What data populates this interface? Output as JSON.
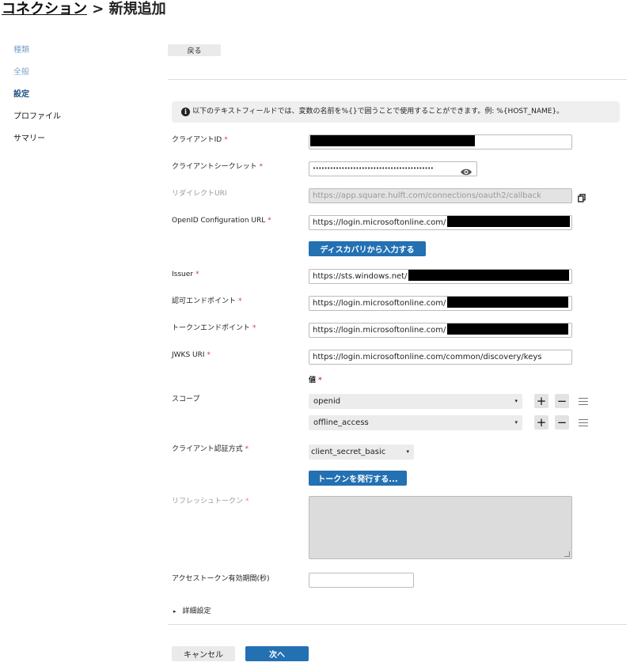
{
  "title": {
    "link": "コネクション",
    "rest": " > 新規追加"
  },
  "nav": [
    {
      "label": "種類",
      "state": "done"
    },
    {
      "label": "全般",
      "state": "done"
    },
    {
      "label": "設定",
      "state": "current"
    },
    {
      "label": "プロファイル",
      "state": "todo"
    },
    {
      "label": "サマリー",
      "state": "todo"
    }
  ],
  "back_label": "戻る",
  "info_text": "以下のテキストフィールドでは、変数の名前を%{}で囲うことで使用することができます。例: %{HOST_NAME}。",
  "required_mark": "*",
  "fields": {
    "client_id": {
      "label": "クライアントID"
    },
    "client_secret": {
      "label": "クライアントシークレット",
      "value": "••••••••••••••••••••••••••••••••••••••••••"
    },
    "redirect_uri": {
      "label": "リダイレクトURI",
      "value": "https://app.square.hulft.com/connections/oauth2/callback"
    },
    "openid_url": {
      "label": "OpenID Configuration URL",
      "value": "https://login.microsoftonline.com/"
    },
    "issuer": {
      "label": "Issuer",
      "value": "https://sts.windows.net/"
    },
    "auth_endpoint": {
      "label": "認可エンドポイント",
      "value": "https://login.microsoftonline.com/"
    },
    "token_endpoint": {
      "label": "トークンエンドポイント",
      "value": "https://login.microsoftonline.com/"
    },
    "jwks_uri": {
      "label": "JWKS URI",
      "value": "https://login.microsoftonline.com/common/discovery/keys"
    }
  },
  "discover_button": "ディスカバリから入力する",
  "scope": {
    "header": "値",
    "label": "スコープ",
    "values": [
      "openid",
      "offline_access"
    ]
  },
  "client_auth": {
    "label": "クライアント認証方式",
    "value": "client_secret_basic"
  },
  "issue_token_button": "トークンを発行する...",
  "refresh_token_label": "リフレッシュトークン",
  "access_token_ttl_label": "アクセストークン有効期間(秒)",
  "advanced_label": "詳細設定",
  "cancel_label": "キャンセル",
  "next_label": "次へ",
  "icons": {
    "info": "info-icon",
    "eye": "eye-icon",
    "copy": "copy-icon",
    "plus": "+",
    "minus": "−",
    "caret": "▾",
    "triangle": "▸"
  },
  "colors": {
    "primary": "#2370b3",
    "required": "#d04040",
    "nav_current": "#1a4f82",
    "nav_done": "#7ea6cc"
  }
}
